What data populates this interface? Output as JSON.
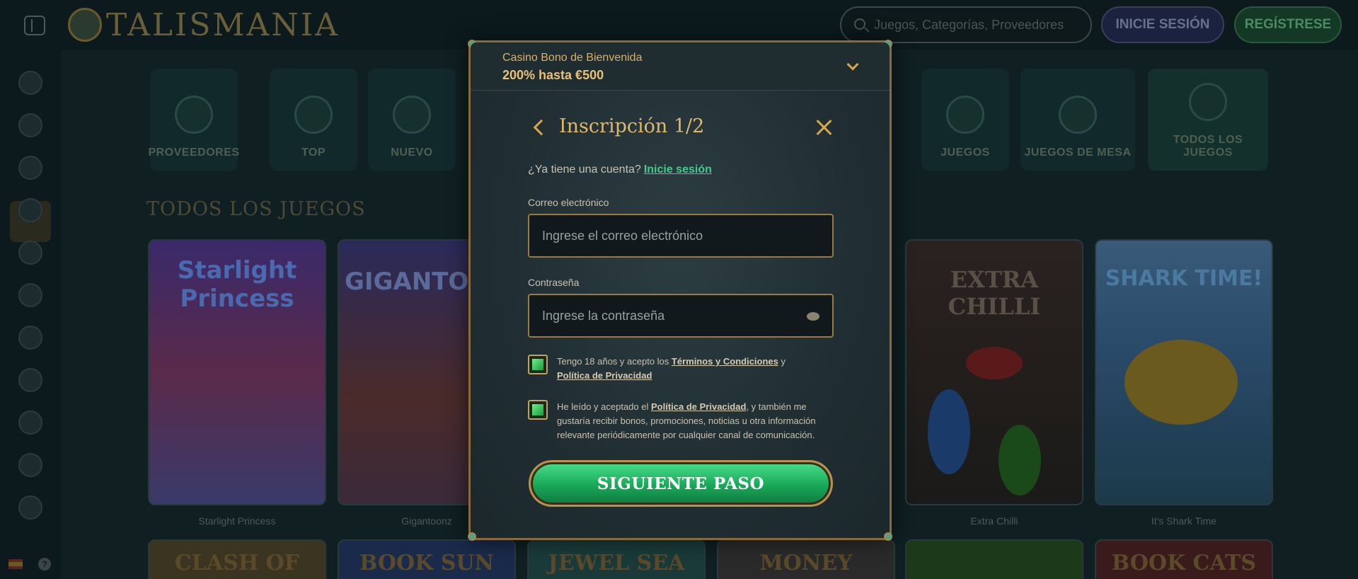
{
  "header": {
    "logo_text": "TALISMANIA",
    "search_placeholder": "Juegos, Categorías, Proveedores",
    "login_label": "INICIE SESIÓN",
    "register_label": "REGÍSTRESE"
  },
  "categories": [
    {
      "label": "PROVEEDORES"
    },
    {
      "label": "TOP"
    },
    {
      "label": "NUEVO"
    },
    {
      "label": "JUEGOS"
    },
    {
      "label": "JUEGOS DE MESA"
    },
    {
      "label": "TODOS LOS JUEGOS"
    }
  ],
  "section_title": "TODOS LOS JUEGOS",
  "games": [
    {
      "name": "Starlight Princess",
      "art": "Starlight Princess"
    },
    {
      "name": "Gigantoonz",
      "art": "GIGANTOO"
    },
    {
      "name": "Extra Chilli",
      "art": "EXTRA CHILLI"
    },
    {
      "name": "It's Shark Time",
      "art": "SHARK TIME!"
    }
  ],
  "games_row2": [
    {
      "label": "CLASH OF GODS"
    },
    {
      "label": "BOOK SUN"
    },
    {
      "label": "JEWEL SEA"
    },
    {
      "label": "MONEY"
    },
    {
      "label": ""
    },
    {
      "label": "BOOK CATS"
    }
  ],
  "modal": {
    "bonus_title": "Casino Bono de Bienvenida",
    "bonus_amount": "200% hasta €500",
    "title": "Inscripción 1/2",
    "account_question": "¿Ya tiene una cuenta?",
    "account_link": "Inicie sesión",
    "email_label": "Correo electrónico",
    "email_placeholder": "Ingrese el correo electrónico",
    "password_label": "Contraseña",
    "password_placeholder": "Ingrese la contraseña",
    "terms_text_1": "Tengo 18 años y acepto los",
    "terms_link": "Términos y Condiciones",
    "terms_text_2": "y",
    "privacy_link": "Política de Privacidad",
    "marketing_text_1": "He leído y aceptado el",
    "marketing_link": "Política de Privacidad",
    "marketing_text_2": ", y también me gustaría recibir bonos, promociones, noticias u otra información relevante periódicamente por cualquier canal de comunicación.",
    "next_button": "SIGUIENTE PASO"
  },
  "colors": {
    "accent_gold": "#d9a64a",
    "button_green": "#19a858",
    "link_green": "#3fcf8a"
  }
}
